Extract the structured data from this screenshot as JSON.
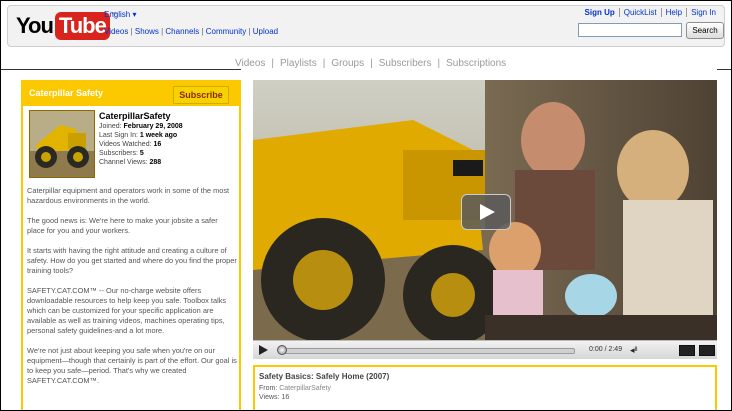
{
  "header": {
    "logo_you": "You",
    "logo_tube": "Tube",
    "logo_tm": "™",
    "language": "English ▾",
    "nav": [
      "Videos",
      "Shows",
      "Channels",
      "Community",
      "Upload"
    ],
    "nav_sep": " | ",
    "links": [
      "Sign Up",
      "QuickList",
      "Help",
      "Sign In"
    ],
    "search_placeholder": "",
    "search_button": "Search"
  },
  "channel_nav": [
    "Videos",
    "Playlists",
    "Groups",
    "Subscribers",
    "Subscriptions"
  ],
  "channel_nav_sep": "|",
  "panel": {
    "title": "Caterpillar Safety",
    "subscribe": "Subscribe",
    "username": "CaterpillarSafety",
    "joined_label": "Joined: ",
    "joined": "February 29, 2008",
    "last_label": "Last Sign In: ",
    "last": "1 week ago",
    "watched_label": "Videos Watched: ",
    "watched": "16",
    "subs_label": "Subscribers: ",
    "subs": "5",
    "views_label": "Channel Views: ",
    "views": "288",
    "paragraphs": [
      "Caterpillar equipment and operators work in some of the most hazardous environments in the world.",
      "The good news is: We're here to make your jobsite a safer place for you and your workers.",
      "It starts with having the right attitude and creating a culture of safety. How do you get started and where do you find the proper training tools?",
      "SAFETY.CAT.COM™ -- Our no-charge website offers downloadable resources to help keep you safe. Toolbox talks which can be customized for your specific application are available as well as training videos, machines operating tips, personal safety guidelines-and a lot more.",
      "We're not just about keeping you safe when you're on our equipment—though that certainly is part of the effort. Our goal is to keep you safe—period. That's why we created SAFETY.CAT.COM™."
    ]
  },
  "player": {
    "time": "0:00 / 2:49",
    "progress": 0,
    "volume_icon": "speaker-icon"
  },
  "video_info": {
    "title": "Safety Basics: Safely Home (2007)",
    "from_label": "From: ",
    "from": "CaterpillarSafety",
    "views_label": "Views: ",
    "views": "16"
  },
  "colors": {
    "accent": "#fcc900",
    "link": "#0033cc",
    "logo_red": "#d8241c"
  }
}
